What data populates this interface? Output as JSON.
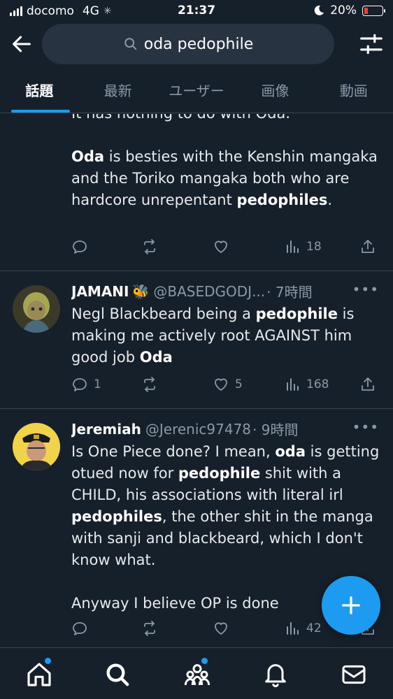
{
  "status": {
    "carrier": "docomo",
    "network": "4G",
    "time": "21:37",
    "battery": "20%",
    "battery_level": 0.2
  },
  "search": {
    "query": "oda pedophile"
  },
  "tabs": [
    {
      "label": "話題",
      "active": true
    },
    {
      "label": "最新"
    },
    {
      "label": "ユーザー"
    },
    {
      "label": "画像"
    },
    {
      "label": "動画"
    }
  ],
  "tweets": [
    {
      "cut_line": "It has nothing to do with Oda.",
      "body_parts": [
        "Oda",
        " is besties with the Kenshin mangaka and the Toriko mangaka both who are hardcore unrepentant ",
        "pedophiles",
        "."
      ],
      "views": "18"
    },
    {
      "name": "JAMANI",
      "emoji": "🐝",
      "handle": "@BASEDGODJ...",
      "time": "· 7時間",
      "body_parts": [
        "Negl Blackbeard being a ",
        "pedophile",
        " is making me actively root AGAINST him good job ",
        "Oda"
      ],
      "replies": "1",
      "likes": "5",
      "views": "168"
    },
    {
      "name": "Jeremiah",
      "handle": "@Jerenic97478",
      "time": "· 9時間",
      "body_parts": [
        "Is One Piece done? I mean, ",
        "oda",
        " is getting otued now for ",
        "pedophile",
        " shit with a CHILD, his associations with literal irl ",
        "pedophiles",
        ", the other shit in the manga with sanji and blackbeard, which I don't know what.",
        "Anyway I believe OP is done"
      ],
      "views": "42"
    }
  ],
  "icons": {
    "back": "arrow-left-icon",
    "search": "search-icon",
    "filter": "sliders-icon",
    "reply": "speech-bubble-icon",
    "retweet": "retweet-icon",
    "like": "heart-icon",
    "views": "bar-chart-icon",
    "share": "share-icon",
    "compose": "plus-icon",
    "home": "home-icon",
    "explore": "search-icon",
    "communities": "people-icon",
    "notifications": "bell-icon",
    "messages": "mail-icon"
  },
  "colors": {
    "background": "#15202b",
    "accent": "#1d9bf0",
    "muted": "#8b98a5",
    "divider": "#38444d"
  }
}
